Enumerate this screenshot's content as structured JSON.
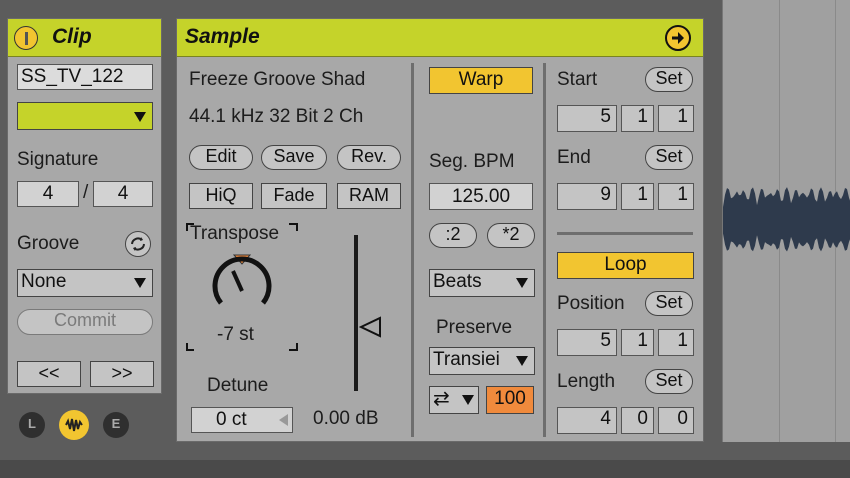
{
  "clip": {
    "title": "Clip",
    "name": "SS_TV_122",
    "signature_label": "Signature",
    "sig_num": "4",
    "sig_sep": "/",
    "sig_den": "4",
    "groove_label": "Groove",
    "groove_value": "None",
    "commit_label": "Commit",
    "prev_label": "<<",
    "next_label": ">>"
  },
  "bottom_buttons": [
    "L",
    "E"
  ],
  "sample": {
    "title": "Sample",
    "file_name": "Freeze Groove Shad",
    "file_info": "44.1 kHz 32 Bit 2 Ch",
    "edit_label": "Edit",
    "save_label": "Save",
    "rev_label": "Rev.",
    "hiq_label": "HiQ",
    "fade_label": "Fade",
    "ram_label": "RAM",
    "transpose_label": "Transpose",
    "transpose_value": "-7 st",
    "detune_label": "Detune",
    "detune_value": "0 ct",
    "gain_value": "0.00 dB",
    "warp_label": "Warp",
    "seg_bpm_label": "Seg. BPM",
    "seg_bpm_value": "125.00",
    "half_label": ":2",
    "double_label": "*2",
    "warp_mode": "Beats",
    "preserve_label": "Preserve",
    "preserve_value": "Transiei",
    "loop_mode_icon": "⇄",
    "envelope_value": "100",
    "start_label": "Start",
    "end_label": "End",
    "set_label": "Set",
    "start_values": [
      "5",
      "1",
      "1"
    ],
    "end_values": [
      "9",
      "1",
      "1"
    ],
    "loop_label": "Loop",
    "position_label": "Position",
    "position_values": [
      "5",
      "1",
      "1"
    ],
    "length_label": "Length",
    "length_values": [
      "4",
      "0",
      "0"
    ]
  },
  "colors": {
    "header": "#c5d32a",
    "toggle_on": "#f2c530",
    "envelope": "#f08a3c",
    "waveform": "#2e3a4c"
  }
}
